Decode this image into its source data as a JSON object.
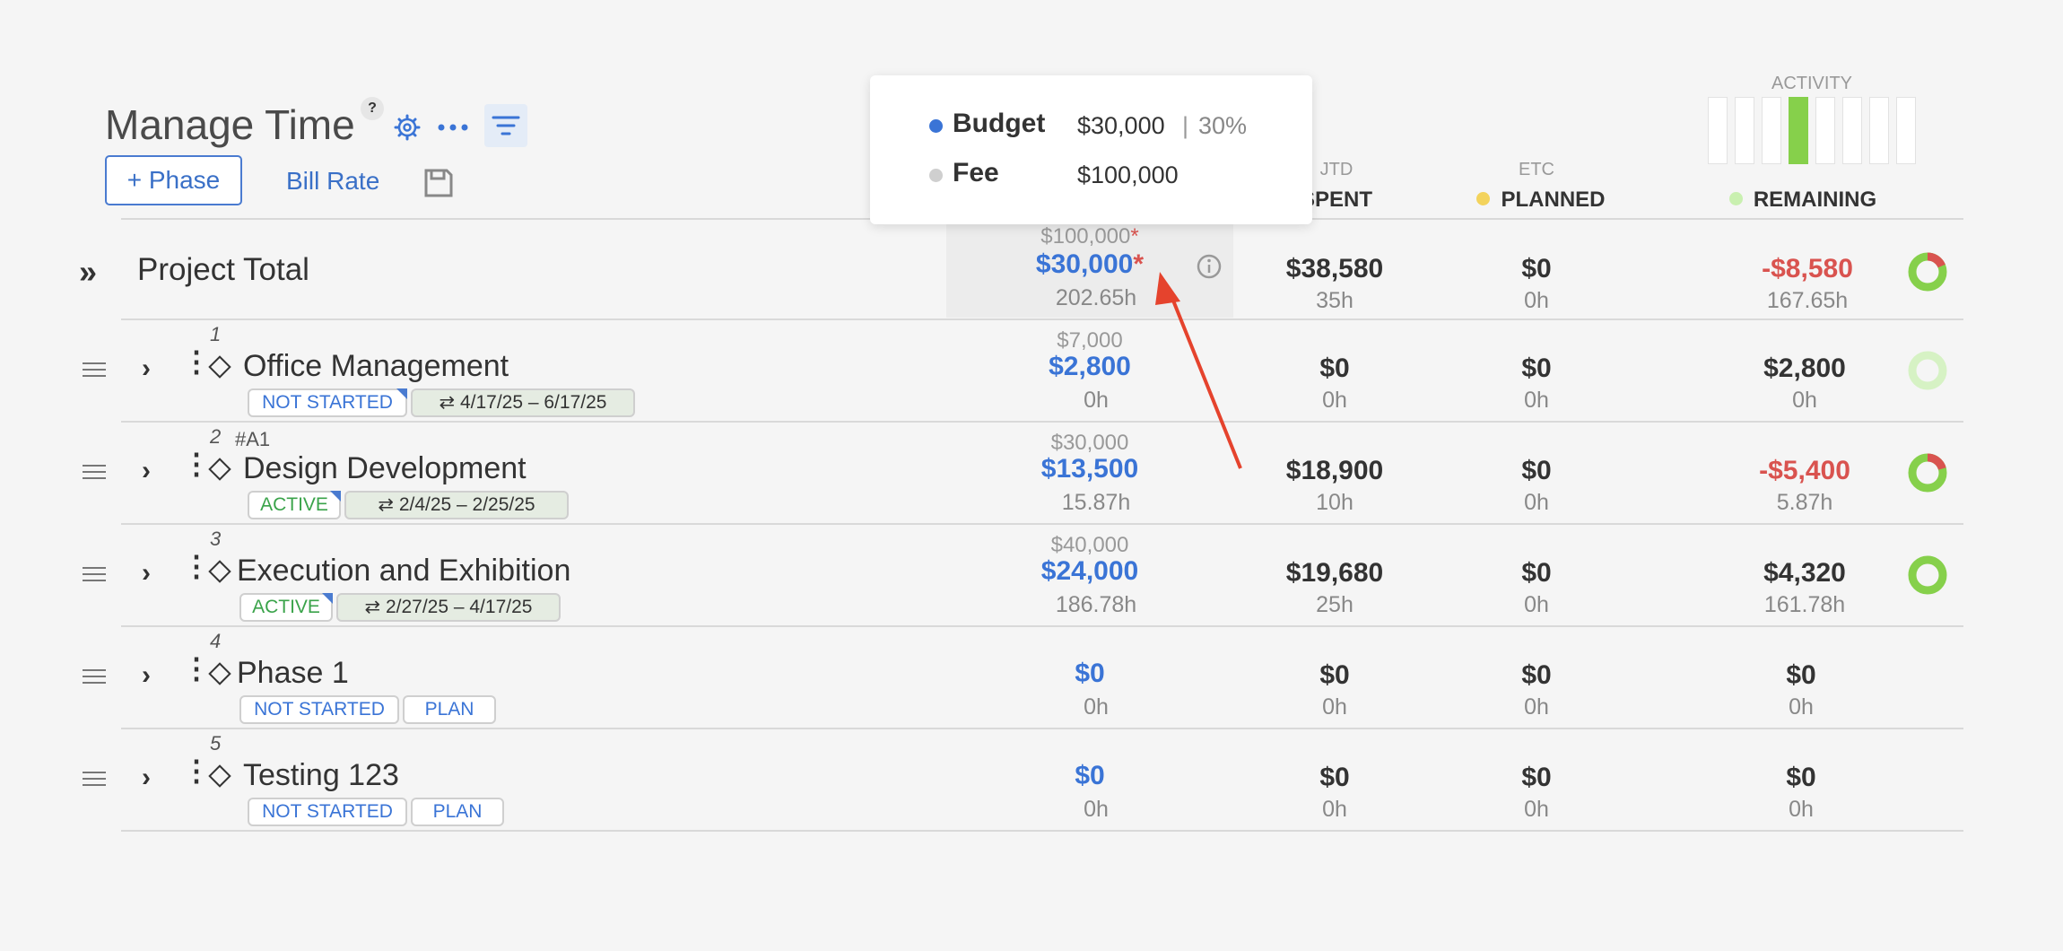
{
  "header": {
    "title": "Manage Time",
    "help": "?",
    "add_phase": "+ Phase",
    "bill_rate": "Bill Rate"
  },
  "columns": {
    "spent_sub": "JTD",
    "spent": "SPENT",
    "planned_sub": "ETC",
    "planned": "PLANNED",
    "remaining": "REMAINING",
    "activity": "ACTIVITY"
  },
  "activity_bars": [
    0,
    0,
    0,
    1,
    0,
    0,
    0,
    0
  ],
  "tooltip": {
    "budget_label": "Budget",
    "budget_value": "$30,000",
    "sep": "|",
    "budget_pct": "30%",
    "fee_label": "Fee",
    "fee_value": "$100,000"
  },
  "project_total": {
    "expand": "»",
    "label": "Project Total",
    "fee": "$100,000",
    "fee_star": "*",
    "budget": "$30,000",
    "budget_star": "*",
    "budget_hours": "202.65h",
    "spent": "$38,580",
    "spent_hours": "35h",
    "planned": "$0",
    "planned_hours": "0h",
    "remaining": "-$8,580",
    "remaining_hours": "167.65h"
  },
  "phases": [
    {
      "index": "1",
      "code": "",
      "name": "Office Management",
      "status": "NOT STARTED",
      "dates": "4/17/25  –  6/17/25",
      "fee": "$7,000",
      "budget": "$2,800",
      "budget_hours": "0h",
      "spent": "$0",
      "spent_hours": "0h",
      "planned": "$0",
      "planned_hours": "0h",
      "remaining": "$2,800",
      "remaining_hours": "0h"
    },
    {
      "index": "2",
      "code": "#A1",
      "name": "Design Development",
      "status": "ACTIVE",
      "dates": "2/4/25   –  2/25/25",
      "fee": "$30,000",
      "budget": "$13,500",
      "budget_hours": "15.87h",
      "spent": "$18,900",
      "spent_hours": "10h",
      "planned": "$0",
      "planned_hours": "0h",
      "remaining": "-$5,400",
      "remaining_hours": "5.87h"
    },
    {
      "index": "3",
      "code": "",
      "name": "Execution and Exhibition",
      "status": "ACTIVE",
      "dates": "2/27/25  –  4/17/25",
      "fee": "$40,000",
      "budget": "$24,000",
      "budget_hours": "186.78h",
      "spent": "$19,680",
      "spent_hours": "25h",
      "planned": "$0",
      "planned_hours": "0h",
      "remaining": "$4,320",
      "remaining_hours": "161.78h"
    },
    {
      "index": "4",
      "code": "",
      "name": "Phase 1",
      "status": "NOT STARTED",
      "plan": "PLAN",
      "budget": "$0",
      "budget_hours": "0h",
      "spent": "$0",
      "spent_hours": "0h",
      "planned": "$0",
      "planned_hours": "0h",
      "remaining": "$0",
      "remaining_hours": "0h"
    },
    {
      "index": "5",
      "code": "",
      "name": "Testing 123",
      "status": "NOT STARTED",
      "plan": "PLAN",
      "budget": "$0",
      "budget_hours": "0h",
      "spent": "$0",
      "spent_hours": "0h",
      "planned": "$0",
      "planned_hours": "0h",
      "remaining": "$0",
      "remaining_hours": "0h"
    }
  ],
  "colors": {
    "accent": "#3a74d6",
    "negative": "#d9534f",
    "active_green": "#3aa34a",
    "activity_green": "#86d04b",
    "planned_dot": "#f3d35c",
    "remaining_dot": "#c9f0b0",
    "annotation_arrow": "#e5432d"
  }
}
